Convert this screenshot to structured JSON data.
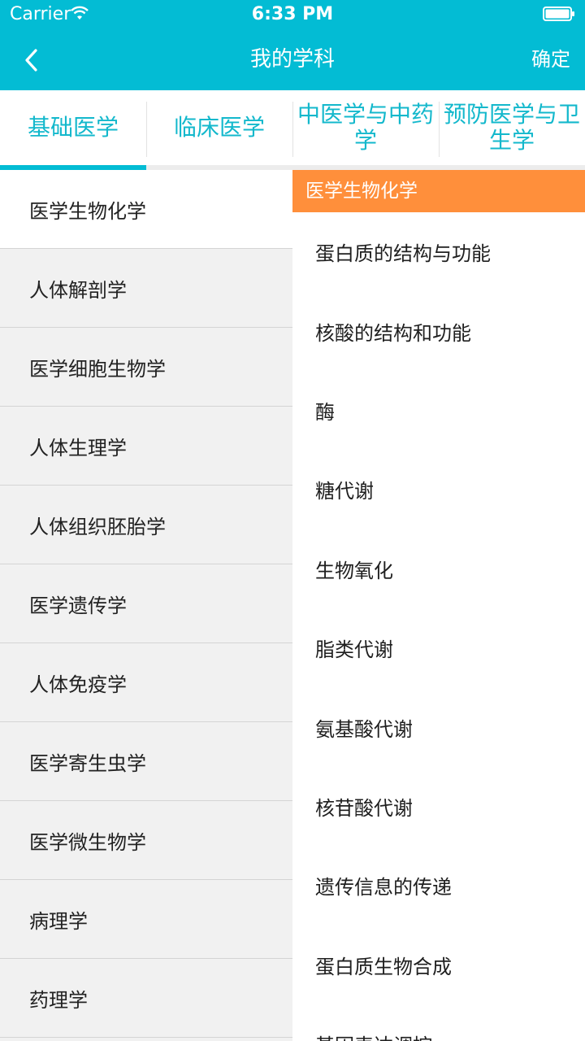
{
  "status_bar": {
    "carrier": "Carrier",
    "time": "6:33 PM"
  },
  "nav": {
    "title": "我的学科",
    "confirm_label": "确定",
    "back_icon": "chevron-left-icon"
  },
  "tabs": [
    {
      "label": "基础医学",
      "selected": true
    },
    {
      "label": "临床医学",
      "selected": false
    },
    {
      "label": "中医学与中药学",
      "selected": false
    },
    {
      "label": "预防医学与卫生学",
      "selected": false
    }
  ],
  "subjects": [
    {
      "label": "医学生物化学",
      "selected": true
    },
    {
      "label": "人体解剖学",
      "selected": false
    },
    {
      "label": "医学细胞生物学",
      "selected": false
    },
    {
      "label": "人体生理学",
      "selected": false
    },
    {
      "label": "人体组织胚胎学",
      "selected": false
    },
    {
      "label": "医学遗传学",
      "selected": false
    },
    {
      "label": "人体免疫学",
      "selected": false
    },
    {
      "label": "医学寄生虫学",
      "selected": false
    },
    {
      "label": "医学微生物学",
      "selected": false
    },
    {
      "label": "病理学",
      "selected": false
    },
    {
      "label": "药理学",
      "selected": false
    }
  ],
  "chapters": {
    "header": "医学生物化学",
    "items": [
      "蛋白质的结构与功能",
      "核酸的结构和功能",
      "酶",
      "糖代谢",
      "生物氧化",
      "脂类代谢",
      "氨基酸代谢",
      "核苷酸代谢",
      "遗传信息的传递",
      "蛋白质生物合成",
      "基因表达调控"
    ]
  },
  "colors": {
    "primary": "#03bcd4",
    "accent": "#ff8f3b",
    "tab_text": "#13b8cc"
  }
}
